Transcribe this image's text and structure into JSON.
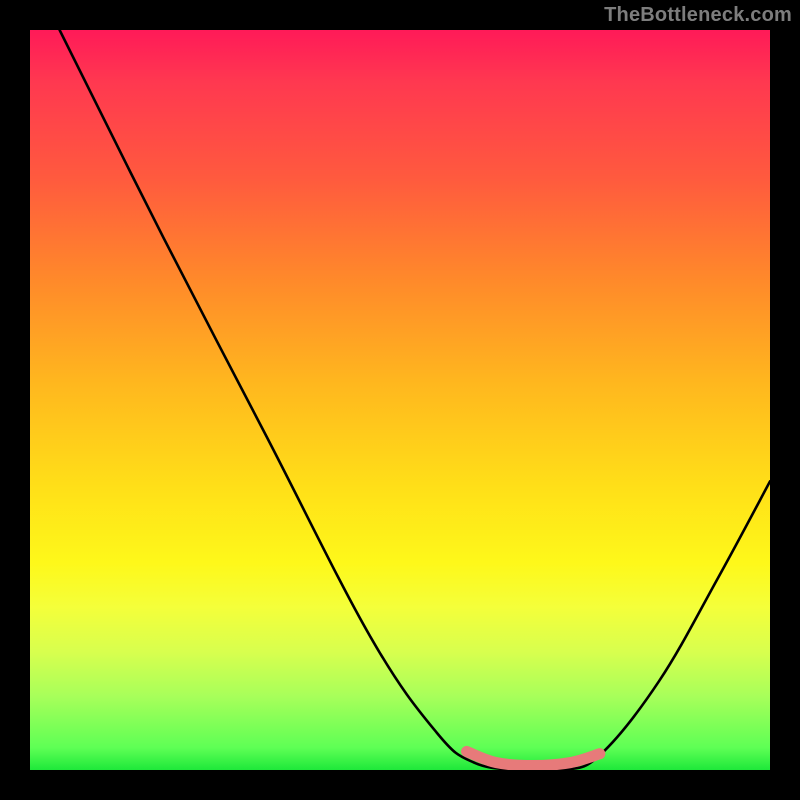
{
  "watermark": "TheBottleneck.com",
  "chart_data": {
    "type": "line",
    "title": "",
    "xlabel": "",
    "ylabel": "",
    "xlim": [
      0,
      100
    ],
    "ylim": [
      0,
      100
    ],
    "background_gradient_stops": [
      {
        "pct": 0,
        "color": "#ff1a58"
      },
      {
        "pct": 20,
        "color": "#ff5a3e"
      },
      {
        "pct": 48,
        "color": "#ffb81e"
      },
      {
        "pct": 72,
        "color": "#fef81a"
      },
      {
        "pct": 90,
        "color": "#a8ff5a"
      },
      {
        "pct": 100,
        "color": "#1ee83a"
      }
    ],
    "series": [
      {
        "name": "bottleneck-curve",
        "color": "#000000",
        "points": [
          {
            "x": 4,
            "y": 100
          },
          {
            "x": 18,
            "y": 72
          },
          {
            "x": 32,
            "y": 45
          },
          {
            "x": 46,
            "y": 18
          },
          {
            "x": 55,
            "y": 5
          },
          {
            "x": 60,
            "y": 1
          },
          {
            "x": 66,
            "y": 0
          },
          {
            "x": 72,
            "y": 0
          },
          {
            "x": 77,
            "y": 2
          },
          {
            "x": 85,
            "y": 12
          },
          {
            "x": 93,
            "y": 26
          },
          {
            "x": 100,
            "y": 39
          }
        ]
      },
      {
        "name": "trough-highlight",
        "color": "#e77a7a",
        "points": [
          {
            "x": 59,
            "y": 2.5
          },
          {
            "x": 63,
            "y": 1.0
          },
          {
            "x": 68,
            "y": 0.6
          },
          {
            "x": 73,
            "y": 1.0
          },
          {
            "x": 77,
            "y": 2.2
          }
        ]
      }
    ]
  }
}
